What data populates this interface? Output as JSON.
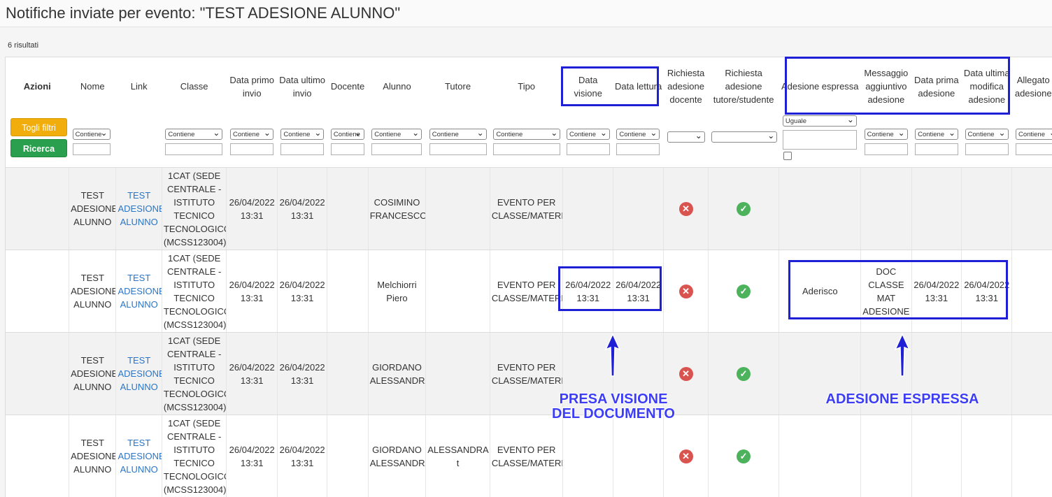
{
  "page": {
    "title": "Notifiche inviate per evento: \"TEST ADESIONE ALUNNO\"",
    "result_count": "6 risultati"
  },
  "buttons": {
    "toggle_filters": "Togli filtri",
    "search": "Ricerca"
  },
  "columns": [
    {
      "key": "azioni",
      "label": "Azioni"
    },
    {
      "key": "nome",
      "label": "Nome",
      "filter": "Contiene"
    },
    {
      "key": "link",
      "label": "Link"
    },
    {
      "key": "classe",
      "label": "Classe",
      "filter": "Contiene"
    },
    {
      "key": "data_primo_invio",
      "label": "Data primo invio",
      "filter": "Contiene"
    },
    {
      "key": "data_ultimo_invio",
      "label": "Data ultimo invio",
      "filter": "Contiene"
    },
    {
      "key": "docente",
      "label": "Docente",
      "filter": "Contiene"
    },
    {
      "key": "alunno",
      "label": "Alunno",
      "filter": "Contiene"
    },
    {
      "key": "tutore",
      "label": "Tutore",
      "filter": "Contiene"
    },
    {
      "key": "tipo",
      "label": "Tipo",
      "filter": "Contiene"
    },
    {
      "key": "data_visione",
      "label": "Data visione",
      "filter": "Contiene"
    },
    {
      "key": "data_lettura",
      "label": "Data lettura",
      "filter": "Contiene"
    },
    {
      "key": "richiesta_adesione_docente",
      "label": "Richiesta adesione docente",
      "filter": ""
    },
    {
      "key": "richiesta_adesione_tutore",
      "label": "Richiesta adesione tutore/studente",
      "filter": ""
    },
    {
      "key": "adesione_espressa",
      "label": "Adesione espressa",
      "filter": "Uguale"
    },
    {
      "key": "messaggio_aggiuntivo",
      "label": "Messaggio aggiuntivo adesione",
      "filter": "Contiene"
    },
    {
      "key": "data_prima_adesione",
      "label": "Data prima adesione",
      "filter": "Contiene"
    },
    {
      "key": "data_ultima_modifica",
      "label": "Data ultima modifica adesione",
      "filter": "Contiene"
    },
    {
      "key": "allegato",
      "label": "Allegato adesione",
      "filter": "Contiene"
    }
  ],
  "rows": [
    {
      "nome": "TEST ADESIONE ALUNNO",
      "link": "TEST ADESIONE ALUNNO",
      "classe": "1CAT (SEDE CENTRALE - ISTITUTO TECNICO TECNOLOGICO (MCSS123004))",
      "data_primo_invio": "26/04/2022 13:31",
      "data_ultimo_invio": "26/04/2022 13:31",
      "docente": "",
      "alunno": "COSIMINO FRANCESCO",
      "tutore": "",
      "tipo": "EVENTO PER CLASSE/MATERIA",
      "data_visione": "",
      "data_lettura": "",
      "richiesta_adesione_docente": "no",
      "richiesta_adesione_tutore": "yes",
      "adesione_espressa": "",
      "messaggio_aggiuntivo": "",
      "data_prima_adesione": "",
      "data_ultima_modifica": ""
    },
    {
      "nome": "TEST ADESIONE ALUNNO",
      "link": "TEST ADESIONE ALUNNO",
      "classe": "1CAT (SEDE CENTRALE - ISTITUTO TECNICO TECNOLOGICO (MCSS123004))",
      "data_primo_invio": "26/04/2022 13:31",
      "data_ultimo_invio": "26/04/2022 13:31",
      "docente": "",
      "alunno": "Melchiorri Piero",
      "tutore": "",
      "tipo": "EVENTO PER CLASSE/MATERIA",
      "data_visione": "26/04/2022 13:31",
      "data_lettura": "26/04/2022 13:31",
      "richiesta_adesione_docente": "no",
      "richiesta_adesione_tutore": "yes",
      "adesione_espressa": "Aderisco",
      "messaggio_aggiuntivo": "DOC CLASSE MAT ADESIONE",
      "data_prima_adesione": "26/04/2022 13:31",
      "data_ultima_modifica": "26/04/2022 13:31"
    },
    {
      "nome": "TEST ADESIONE ALUNNO",
      "link": "TEST ADESIONE ALUNNO",
      "classe": "1CAT (SEDE CENTRALE - ISTITUTO TECNICO TECNOLOGICO (MCSS123004))",
      "data_primo_invio": "26/04/2022 13:31",
      "data_ultimo_invio": "26/04/2022 13:31",
      "docente": "",
      "alunno": "GIORDANO ALESSANDRA",
      "tutore": "",
      "tipo": "EVENTO PER CLASSE/MATERIA",
      "data_visione": "",
      "data_lettura": "",
      "richiesta_adesione_docente": "no",
      "richiesta_adesione_tutore": "yes",
      "adesione_espressa": "",
      "messaggio_aggiuntivo": "",
      "data_prima_adesione": "",
      "data_ultima_modifica": ""
    },
    {
      "nome": "TEST ADESIONE ALUNNO",
      "link": "TEST ADESIONE ALUNNO",
      "classe": "1CAT (SEDE CENTRALE - ISTITUTO TECNICO TECNOLOGICO (MCSS123004))",
      "data_primo_invio": "26/04/2022 13:31",
      "data_ultimo_invio": "26/04/2022 13:31",
      "docente": "",
      "alunno": "GIORDANO ALESSANDRA",
      "tutore": "ALESSANDRA t",
      "tipo": "EVENTO PER CLASSE/MATERIA",
      "data_visione": "",
      "data_lettura": "",
      "richiesta_adesione_docente": "no",
      "richiesta_adesione_tutore": "yes",
      "adesione_espressa": "",
      "messaggio_aggiuntivo": "",
      "data_prima_adesione": "",
      "data_ultima_modifica": ""
    }
  ],
  "annotations": {
    "presa_visione": "PRESA VISIONE\nDEL DOCUMENTO",
    "adesione_espressa": "ADESIONE ESPRESSA",
    "highlight_color": "#1f1fd6",
    "annotation_color": "#3d3df5"
  },
  "icons": {
    "no": "cross-circle-icon",
    "yes": "check-circle-icon"
  },
  "colors": {
    "toggle_button": "#f0ad0b",
    "search_button": "#2aa04f",
    "link": "#2a75c8",
    "error": "#d9534f",
    "success": "#4cb25c"
  }
}
